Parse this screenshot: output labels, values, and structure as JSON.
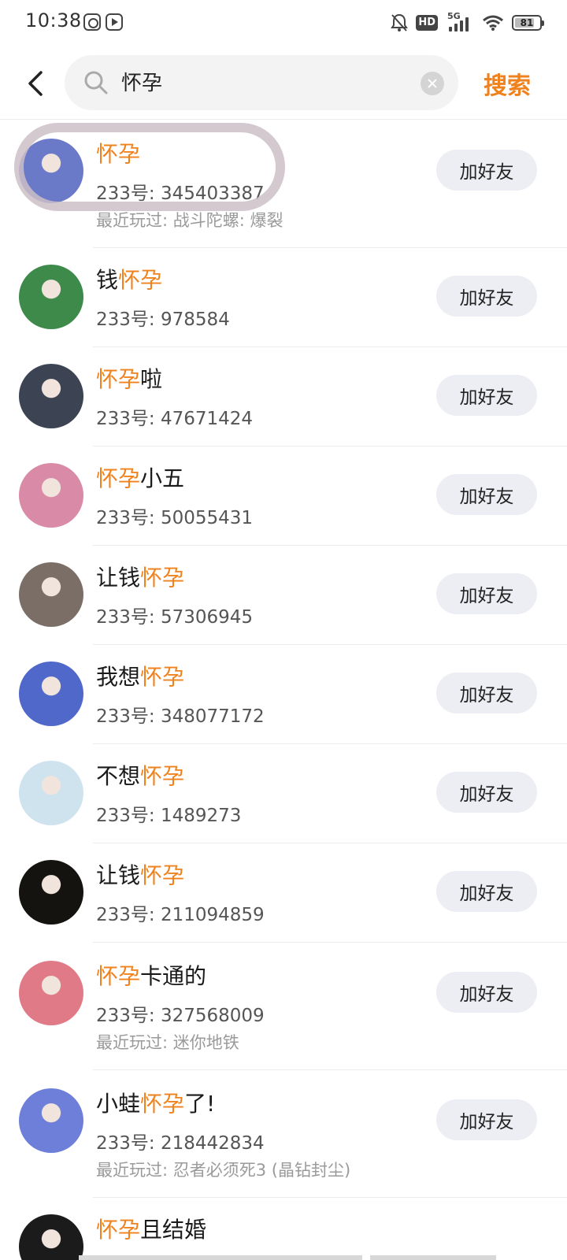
{
  "status": {
    "time": "10:38",
    "hd_label": "HD",
    "network": "5G",
    "battery": "81",
    "battery_level": 0.81
  },
  "search": {
    "query": "怀孕",
    "submit_label": "搜索"
  },
  "results": [
    {
      "name_before": "",
      "name_hl": "怀孕",
      "name_after": "",
      "id": "233号: 345403387",
      "recent": "最近玩过: 战斗陀螺: 爆裂",
      "add_label": "加好友",
      "avatar_color": "#6b79c9"
    },
    {
      "name_before": "钱",
      "name_hl": "怀孕",
      "name_after": "",
      "id": "233号: 978584",
      "recent": "",
      "add_label": "加好友",
      "avatar_color": "#3e8a4b"
    },
    {
      "name_before": "",
      "name_hl": "怀孕",
      "name_after": "啦",
      "id": "233号: 47671424",
      "recent": "",
      "add_label": "加好友",
      "avatar_color": "#3c4454"
    },
    {
      "name_before": "",
      "name_hl": "怀孕",
      "name_after": "小五",
      "id": "233号: 50055431",
      "recent": "",
      "add_label": "加好友",
      "avatar_color": "#d98aa6"
    },
    {
      "name_before": "让钱",
      "name_hl": "怀孕",
      "name_after": "",
      "id": "233号: 57306945",
      "recent": "",
      "add_label": "加好友",
      "avatar_color": "#7a6e66"
    },
    {
      "name_before": "我想",
      "name_hl": "怀孕",
      "name_after": "",
      "id": "233号: 348077172",
      "recent": "",
      "add_label": "加好友",
      "avatar_color": "#4f68c9"
    },
    {
      "name_before": "不想",
      "name_hl": "怀孕",
      "name_after": "",
      "id": "233号: 1489273",
      "recent": "",
      "add_label": "加好友",
      "avatar_color": "#cfe3ef"
    },
    {
      "name_before": "让钱",
      "name_hl": "怀孕",
      "name_after": "",
      "id": "233号: 211094859",
      "recent": "",
      "add_label": "加好友",
      "avatar_color": "#15130f"
    },
    {
      "name_before": "",
      "name_hl": "怀孕",
      "name_after": "卡通的",
      "id": "233号: 327568009",
      "recent": "最近玩过: 迷你地铁",
      "add_label": "加好友",
      "avatar_color": "#e07a86"
    },
    {
      "name_before": "小蛙",
      "name_hl": "怀孕",
      "name_after": "了!",
      "id": "233号: 218442834",
      "recent": "最近玩过: 忍者必须死3 (晶钻封尘)",
      "add_label": "加好友",
      "avatar_color": "#6d7fd9"
    },
    {
      "name_before": "",
      "name_hl": "怀孕",
      "name_after": "且结婚",
      "id": "",
      "recent": "",
      "add_label": "",
      "avatar_color": "#1b1b1b"
    }
  ]
}
